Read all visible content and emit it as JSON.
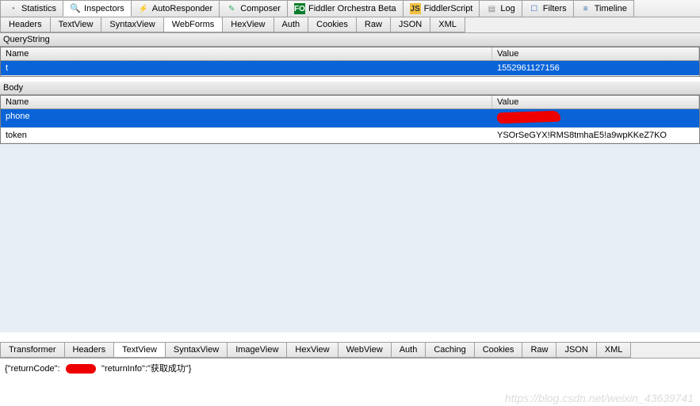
{
  "topTabs": [
    {
      "label": "Statistics",
      "icon": "stat"
    },
    {
      "label": "Inspectors",
      "icon": "insp",
      "active": true
    },
    {
      "label": "AutoResponder",
      "icon": "auto"
    },
    {
      "label": "Composer",
      "icon": "comp"
    },
    {
      "label": "Fiddler Orchestra Beta",
      "icon": "orch",
      "badge": "FO"
    },
    {
      "label": "FiddlerScript",
      "icon": "fs",
      "badge": "JS"
    },
    {
      "label": "Log",
      "icon": "log"
    },
    {
      "label": "Filters",
      "icon": "filt"
    },
    {
      "label": "Timeline",
      "icon": "time"
    }
  ],
  "reqTabs": [
    "Headers",
    "TextView",
    "SyntaxView",
    "WebForms",
    "HexView",
    "Auth",
    "Cookies",
    "Raw",
    "JSON",
    "XML"
  ],
  "reqActive": "WebForms",
  "sections": {
    "query": {
      "title": "QueryString",
      "headers": {
        "name": "Name",
        "value": "Value"
      },
      "rows": [
        {
          "name": "t",
          "value": "1552961127156",
          "selected": true
        }
      ]
    },
    "body": {
      "title": "Body",
      "headers": {
        "name": "Name",
        "value": "Value"
      },
      "rows": [
        {
          "name": "phone",
          "value": "[redacted]",
          "selected": true,
          "redacted": true
        },
        {
          "name": "token",
          "value": "YSOrSeGYX!RMS8tmhaE5!a9wpKKeZ7KO"
        }
      ]
    }
  },
  "respTabs": [
    "Transformer",
    "Headers",
    "TextView",
    "SyntaxView",
    "ImageView",
    "HexView",
    "WebView",
    "Auth",
    "Caching",
    "Cookies",
    "Raw",
    "JSON",
    "XML"
  ],
  "respActive": "TextView",
  "textview": {
    "prefix": "{\"returnCode\":",
    "mid": "\"returnInfo\":\"获取成功\"}",
    "redacted": true
  },
  "watermark": "https://blog.csdn.net/weixin_43639741"
}
